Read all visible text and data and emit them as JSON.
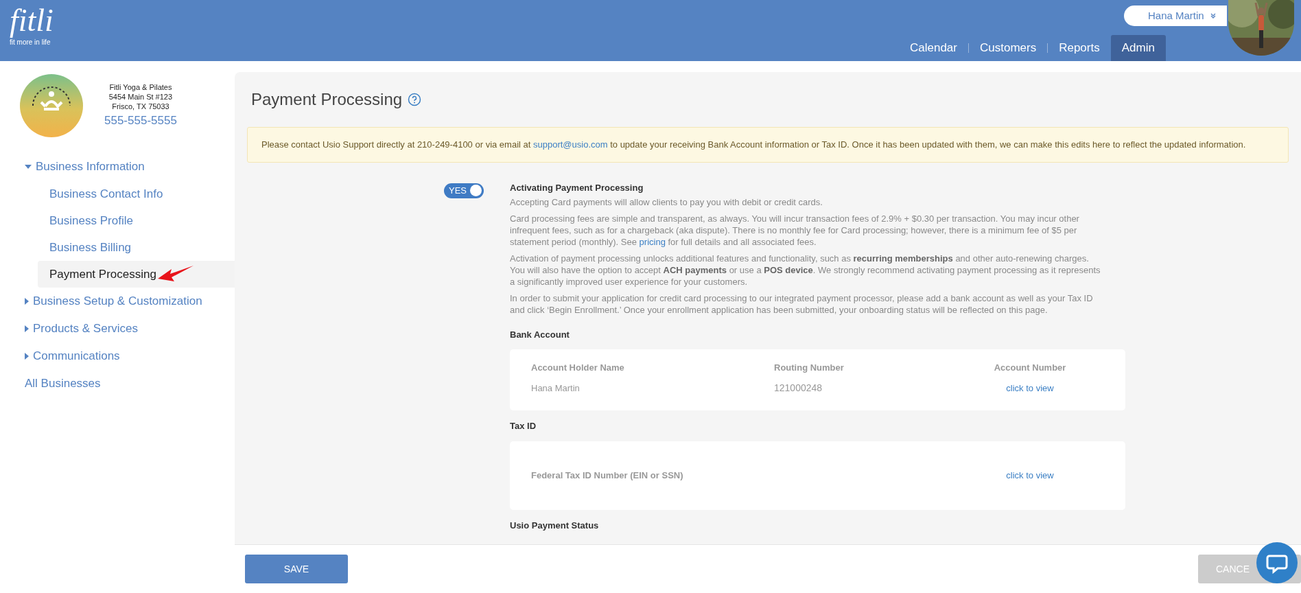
{
  "header": {
    "logo": {
      "name": "fitli",
      "tagline": "fit more in life"
    },
    "user": {
      "name": "Hana Martin"
    },
    "nav": [
      {
        "label": "Calendar",
        "selected": false
      },
      {
        "label": "Customers",
        "selected": false
      },
      {
        "label": "Reports",
        "selected": false
      },
      {
        "label": "Admin",
        "selected": true
      }
    ]
  },
  "sidebar": {
    "business": {
      "name": "Fitli Yoga & Pilates",
      "address_line1": "5454 Main St #123",
      "address_line2": "Frisco, TX 75033",
      "phone": "555-555-5555"
    },
    "menu": [
      {
        "kind": "group",
        "label": "Business Information",
        "expanded": true,
        "children": [
          {
            "label": "Business Contact Info",
            "selected": false
          },
          {
            "label": "Business Profile",
            "selected": false
          },
          {
            "label": "Business Billing",
            "selected": false
          },
          {
            "label": "Payment Processing",
            "selected": true
          }
        ]
      },
      {
        "kind": "group",
        "label": "Business Setup & Customization",
        "expanded": false
      },
      {
        "kind": "group",
        "label": "Products & Services",
        "expanded": false
      },
      {
        "kind": "group",
        "label": "Communications",
        "expanded": false
      },
      {
        "kind": "link",
        "label": "All Businesses"
      }
    ]
  },
  "page": {
    "title": "Payment Processing",
    "notice": {
      "before": "Please contact Usio Support directly at 210-249-4100 or via email at",
      "link": "support@usio.com",
      "after": "to update your receiving Bank Account information or Tax ID. Once it has been updated with them, we can make this edits here to reflect the updated information."
    },
    "toggle": {
      "label": "YES",
      "on": true
    },
    "heading": "Activating Payment Processing",
    "paragraphs": [
      {
        "kind": "text",
        "text": "Accepting Card payments will allow clients to pay you with debit or credit cards."
      },
      {
        "kind": "link",
        "before": "Card processing fees are simple and transparent, as always. You will incur transaction fees of 2.9% + $0.30 per transaction. You may incur other infrequent fees, such as for a chargeback (aka dispute). There is no monthly fee for Card processing; however, there is a minimum fee of $5 per statement period (monthly). See",
        "link": "pricing",
        "after": "for full details and all associated fees."
      },
      {
        "kind": "text",
        "text": "Activation of payment processing unlocks additional features and functionality, such as **recurring memberships** and other auto-renewing charges. You will also have the option to accept **ACH payments** or use a **POS device**. We strongly recommend activating payment processing as it represents a significantly improved user experience for your customers."
      },
      {
        "kind": "text",
        "text": "In order to submit your application for credit card processing to our integrated payment processor, please add a bank account as well as your Tax ID and click ‘Begin Enrollment.’ Once your enrollment application has been submitted, your onboarding status will be reflected on this page."
      }
    ],
    "bank_account": {
      "heading": "Bank Account",
      "columns": [
        "Account Holder Name",
        "Routing Number",
        "Account Number"
      ],
      "row": [
        "Hana Martin",
        "121000248",
        "click to view"
      ]
    },
    "tax_id": {
      "heading": "Tax ID",
      "label": "Federal Tax ID Number (EIN or SSN)",
      "value": "click to view"
    },
    "next_heading": "Usio Payment Status"
  },
  "footer": {
    "save": "SAVE",
    "cancel": "CANCE"
  }
}
